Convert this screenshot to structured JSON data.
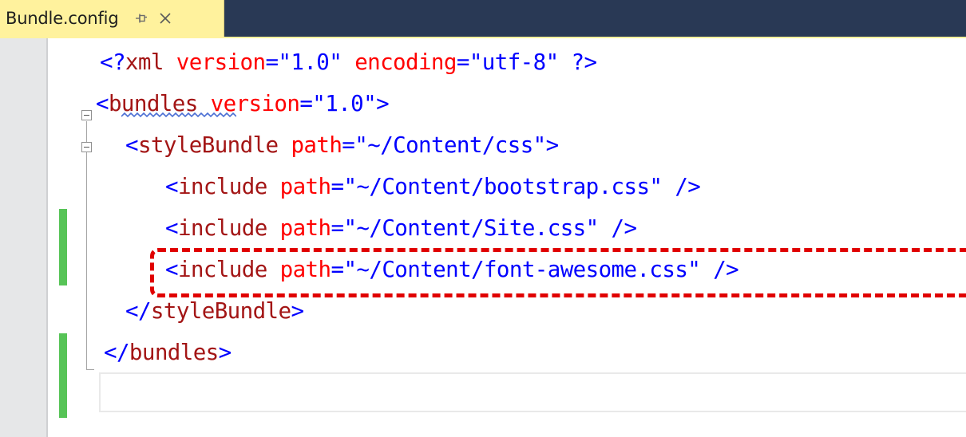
{
  "tab": {
    "title": "Bundle.config",
    "pin_icon": "pin-icon",
    "close_icon": "close-icon"
  },
  "colors": {
    "tabstrip": "#293955",
    "active_tab": "#fff29d",
    "xml_delimiter": "#0000ff",
    "xml_name": "#a31515",
    "xml_attribute": "#ff0000",
    "change_marker": "#57c457",
    "highlight": "#e00000"
  },
  "code": {
    "line1": {
      "a": "<?",
      "b": "xml",
      "c": " version",
      "d": "=",
      "e": "\"",
      "f": "1.0",
      "g": "\"",
      "h": " encoding",
      "i": "=",
      "j": "\"",
      "k": "utf-8",
      "l": "\"",
      "m": " ?>"
    },
    "line2": {
      "a": "<",
      "b": "bundles",
      "c": " version",
      "d": "=",
      "e": "\"",
      "f": "1.0",
      "g": "\"",
      "h": ">"
    },
    "line3": {
      "a": "<",
      "b": "styleBundle",
      "c": " path",
      "d": "=",
      "e": "\"",
      "f": "~/Content/css",
      "g": "\"",
      "h": ">"
    },
    "line4": {
      "a": "<",
      "b": "include",
      "c": " path",
      "d": "=",
      "e": "\"",
      "f": "~/Content/bootstrap.css",
      "g": "\"",
      "h": " />"
    },
    "line5": {
      "a": "<",
      "b": "include",
      "c": " path",
      "d": "=",
      "e": "\"",
      "f": "~/Content/Site.css",
      "g": "\"",
      "h": " />"
    },
    "line6": {
      "a": "<",
      "b": "include",
      "c": " path",
      "d": "=",
      "e": "\"",
      "f": "~/Content/font-awesome.css",
      "g": "\"",
      "h": " />"
    },
    "line7": {
      "a": "</",
      "b": "styleBundle",
      "c": ">"
    },
    "line8": {
      "a": "</",
      "b": "bundles",
      "c": ">"
    }
  }
}
